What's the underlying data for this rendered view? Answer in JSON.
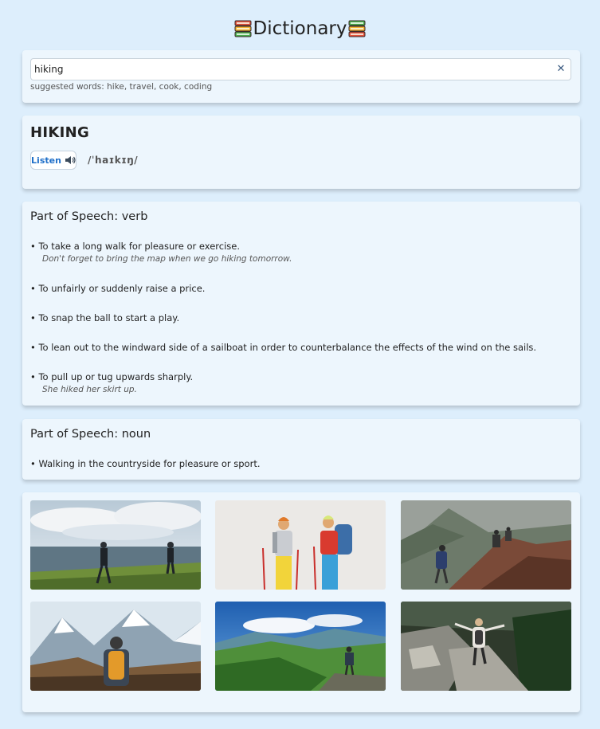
{
  "app": {
    "title": "Dictionary",
    "logo_icon": "books-icon"
  },
  "search": {
    "value": "hiking",
    "placeholder": "",
    "clear_label": "✕",
    "suggestions": "suggested words: hike, travel, cook, coding"
  },
  "entry": {
    "word": "HIKING",
    "listen_label": "Listen",
    "phonetic": "/ˈhaɪkɪŋ/"
  },
  "meanings": [
    {
      "part_of_speech": "Part of Speech: verb",
      "definitions": [
        {
          "text": "• To take a long walk for pleasure or exercise.",
          "example": "Don't forget to bring the map when we go hiking tomorrow."
        },
        {
          "text": "• To unfairly or suddenly raise a price."
        },
        {
          "text": "• To snap the ball to start a play."
        },
        {
          "text": "• To lean out to the windward side of a sailboat in order to counterbalance the effects of the wind on the sails."
        },
        {
          "text": "• To pull up or tug upwards sharply.",
          "example": "She hiked her skirt up."
        }
      ]
    },
    {
      "part_of_speech": "Part of Speech: noun",
      "definitions": [
        {
          "text": "• Walking in the countryside for pleasure or sport."
        }
      ]
    }
  ],
  "gallery": [
    {
      "name": "coast-hikers-photo"
    },
    {
      "name": "studio-hikers-photo"
    },
    {
      "name": "mountain-ridge-hikers-photo"
    },
    {
      "name": "snowy-mountain-hiker-photo"
    },
    {
      "name": "green-valley-hiker-photo"
    },
    {
      "name": "rocky-trail-hiker-photo"
    }
  ]
}
